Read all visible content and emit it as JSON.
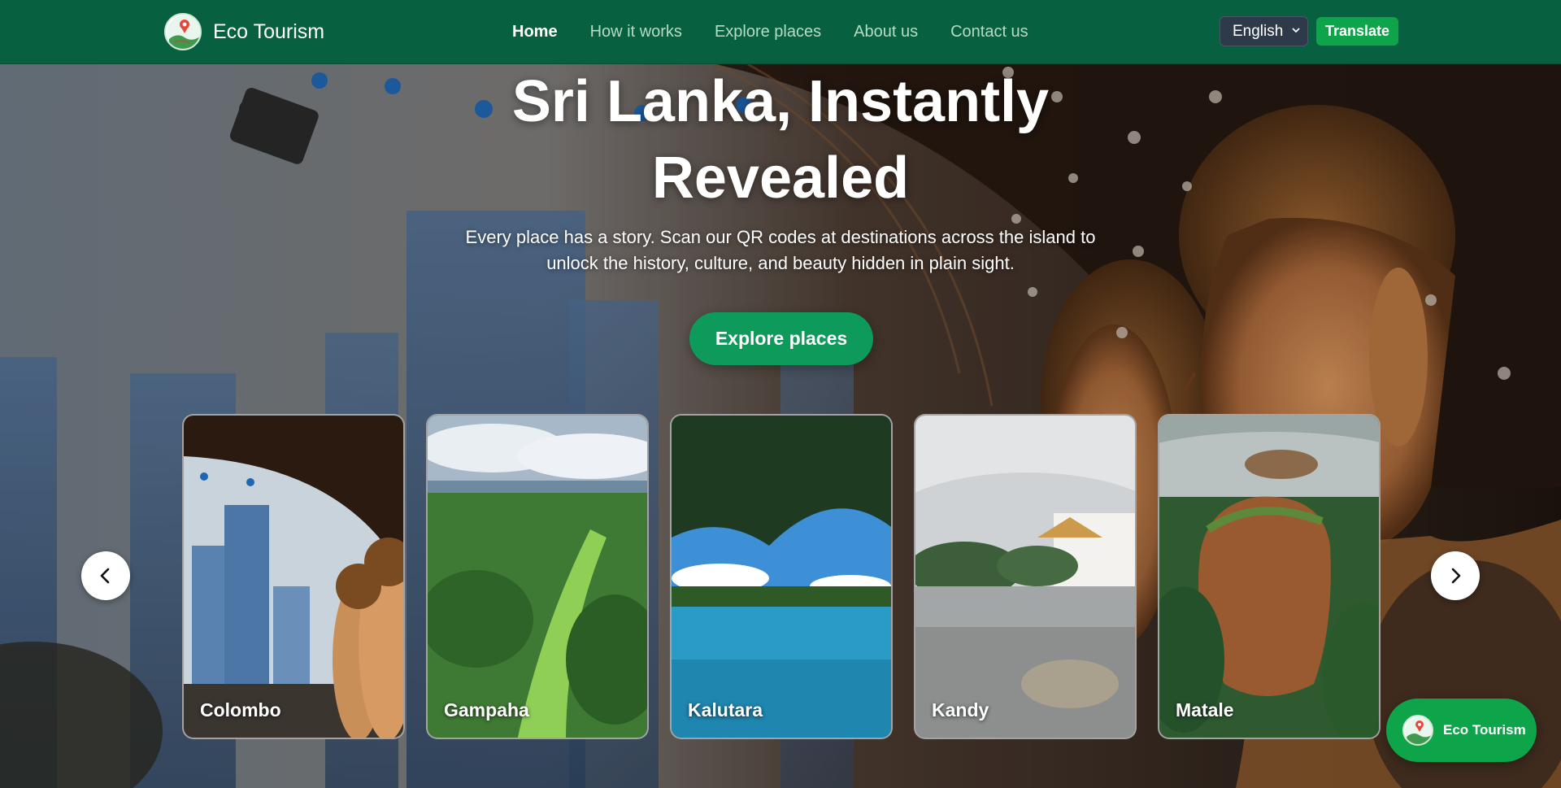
{
  "navbar": {
    "brand": "Eco Tourism",
    "links": [
      {
        "label": "Home",
        "active": true
      },
      {
        "label": "How it works",
        "active": false
      },
      {
        "label": "Explore places",
        "active": false
      },
      {
        "label": "About us",
        "active": false
      },
      {
        "label": "Contact us",
        "active": false
      }
    ],
    "language": {
      "selected": "English"
    },
    "translate_label": "Translate"
  },
  "hero": {
    "title_line1": "Sri Lanka, Instantly",
    "title_line2": "Revealed",
    "subtitle_line1": "Every place has a story. Scan our QR codes at destinations across the island to",
    "subtitle_line2": "unlock the history, culture, and beauty hidden in plain sight.",
    "cta_label": "Explore places"
  },
  "places": [
    {
      "name": "Colombo"
    },
    {
      "name": "Gampaha"
    },
    {
      "name": "Kalutara"
    },
    {
      "name": "Kandy"
    },
    {
      "name": "Matale"
    }
  ],
  "carousel": {
    "prev_icon": "chevron-left-icon",
    "next_icon": "chevron-right-icon"
  },
  "chat_widget": {
    "label": "Eco Tourism"
  },
  "colors": {
    "navbar": "#07603f",
    "accent": "#0d9a5b",
    "translate_button": "#0ea54a",
    "nav_active": "#ffffff",
    "nav_inactive": "#b5dcc3"
  }
}
